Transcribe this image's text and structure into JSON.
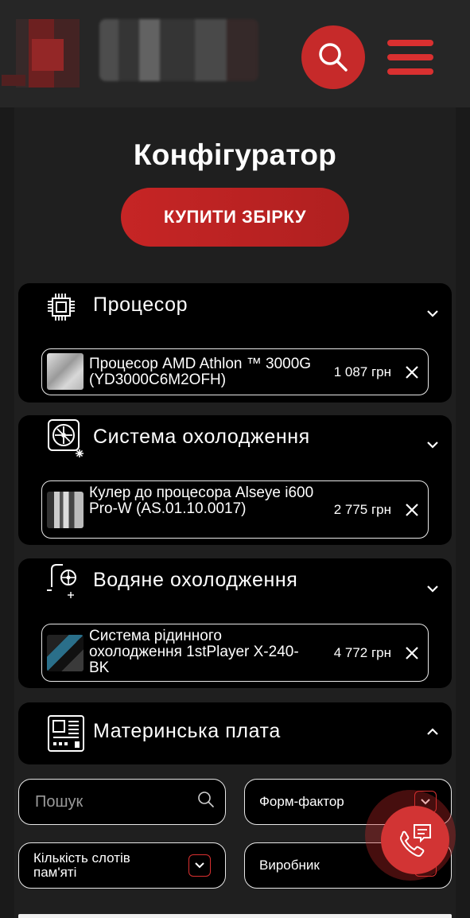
{
  "header": {
    "search_icon": "search-icon",
    "menu_icon": "hamburger-icon"
  },
  "page": {
    "title": "Конфігуратор",
    "buy_button": "КУПИТИ ЗБІРКУ"
  },
  "categories": [
    {
      "title": "Процесор",
      "icon": "cpu-icon",
      "expanded": false,
      "item": {
        "name": "Процесор AMD Athlon ™ 3000G (YD3000C6M2OFH)",
        "price": "1 087 грн"
      }
    },
    {
      "title": "Система охолодження",
      "icon": "cooling-icon",
      "expanded": false,
      "item": {
        "name": "Кулер до процесора Alseye i600 Pro-W (AS.01.10.0017)",
        "price": "2 775 грн"
      }
    },
    {
      "title": "Водяне охолодження",
      "icon": "water-cooling-icon",
      "expanded": false,
      "item": {
        "name": "Система рідинного охолодження 1stPlayer X-240-BK",
        "price": "4 772 грн"
      }
    },
    {
      "title": "Материнська плата",
      "icon": "motherboard-icon",
      "expanded": true
    }
  ],
  "filters": {
    "search_placeholder": "Пошук",
    "form_factor": "Форм-фактор",
    "memory_slots": "Кількість слотів пам'яті",
    "manufacturer": "Виробник"
  },
  "colors": {
    "accent": "#c62a2a",
    "background": "#1a1a1a",
    "card": "#000000"
  }
}
